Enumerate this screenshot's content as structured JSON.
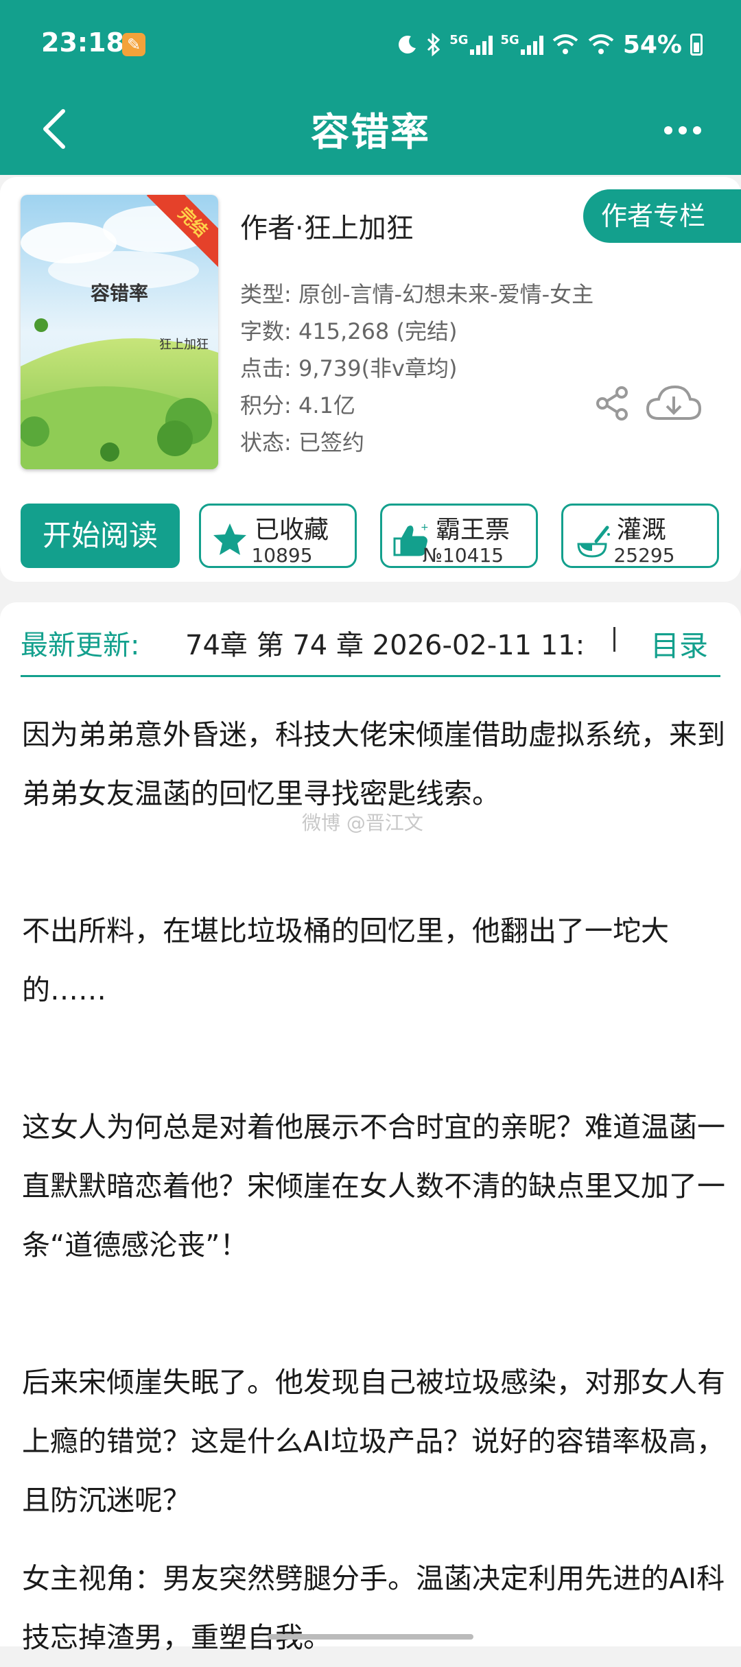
{
  "status_bar": {
    "time": "23:18",
    "net1": "5G",
    "net2": "5G",
    "battery": "54%"
  },
  "header": {
    "title": "容错率"
  },
  "book": {
    "cover_title": "容错率",
    "cover_author": "狂上加狂",
    "cover_badge": "完结",
    "author": "作者·狂上加狂",
    "author_button": "作者专栏",
    "type": "类型: 原创-言情-幻想未来-爱情-女主",
    "words": "字数: 415,268 (完结)",
    "clicks": "点击: 9,739(非v章均)",
    "score": "积分: 4.1亿",
    "state": "状态: 已签约"
  },
  "actions": {
    "read": "开始阅读",
    "collect_label": "已收藏",
    "collect_count": "10895",
    "vote_label": "霸王票",
    "vote_count": "№10415",
    "water_label": "灌溉",
    "water_count": "25295"
  },
  "update": {
    "label": "最新更新:",
    "text": "74章   第 74 章   2026-02-11 11:",
    "toc": "目录"
  },
  "synopsis": {
    "p1": "因为弟弟意外昏迷，科技大佬宋倾崖借助虚拟系统，来到弟弟女友温菡的回忆里寻找密匙线索。",
    "p2": "不出所料，在堪比垃圾桶的回忆里，他翻出了一坨大的……",
    "p3": "这女人为何总是对着他展示不合时宜的亲昵？难道温菡一直默默暗恋着他？宋倾崖在女人数不清的缺点里又加了一条“道德感沦丧”！",
    "p4": "后来宋倾崖失眠了。他发现自己被垃圾感染，对那女人有上瘾的错觉？这是什么AI垃圾产品？说好的容错率极高，且防沉迷呢？",
    "p5": "女主视角：男友突然劈腿分手。温菡决定利用先进的AI科技忘掉渣男，重塑自我。",
    "watermark": "微博 @晋江文"
  },
  "colors": {
    "brand": "#13a08d",
    "badge": "#f3a23a"
  }
}
